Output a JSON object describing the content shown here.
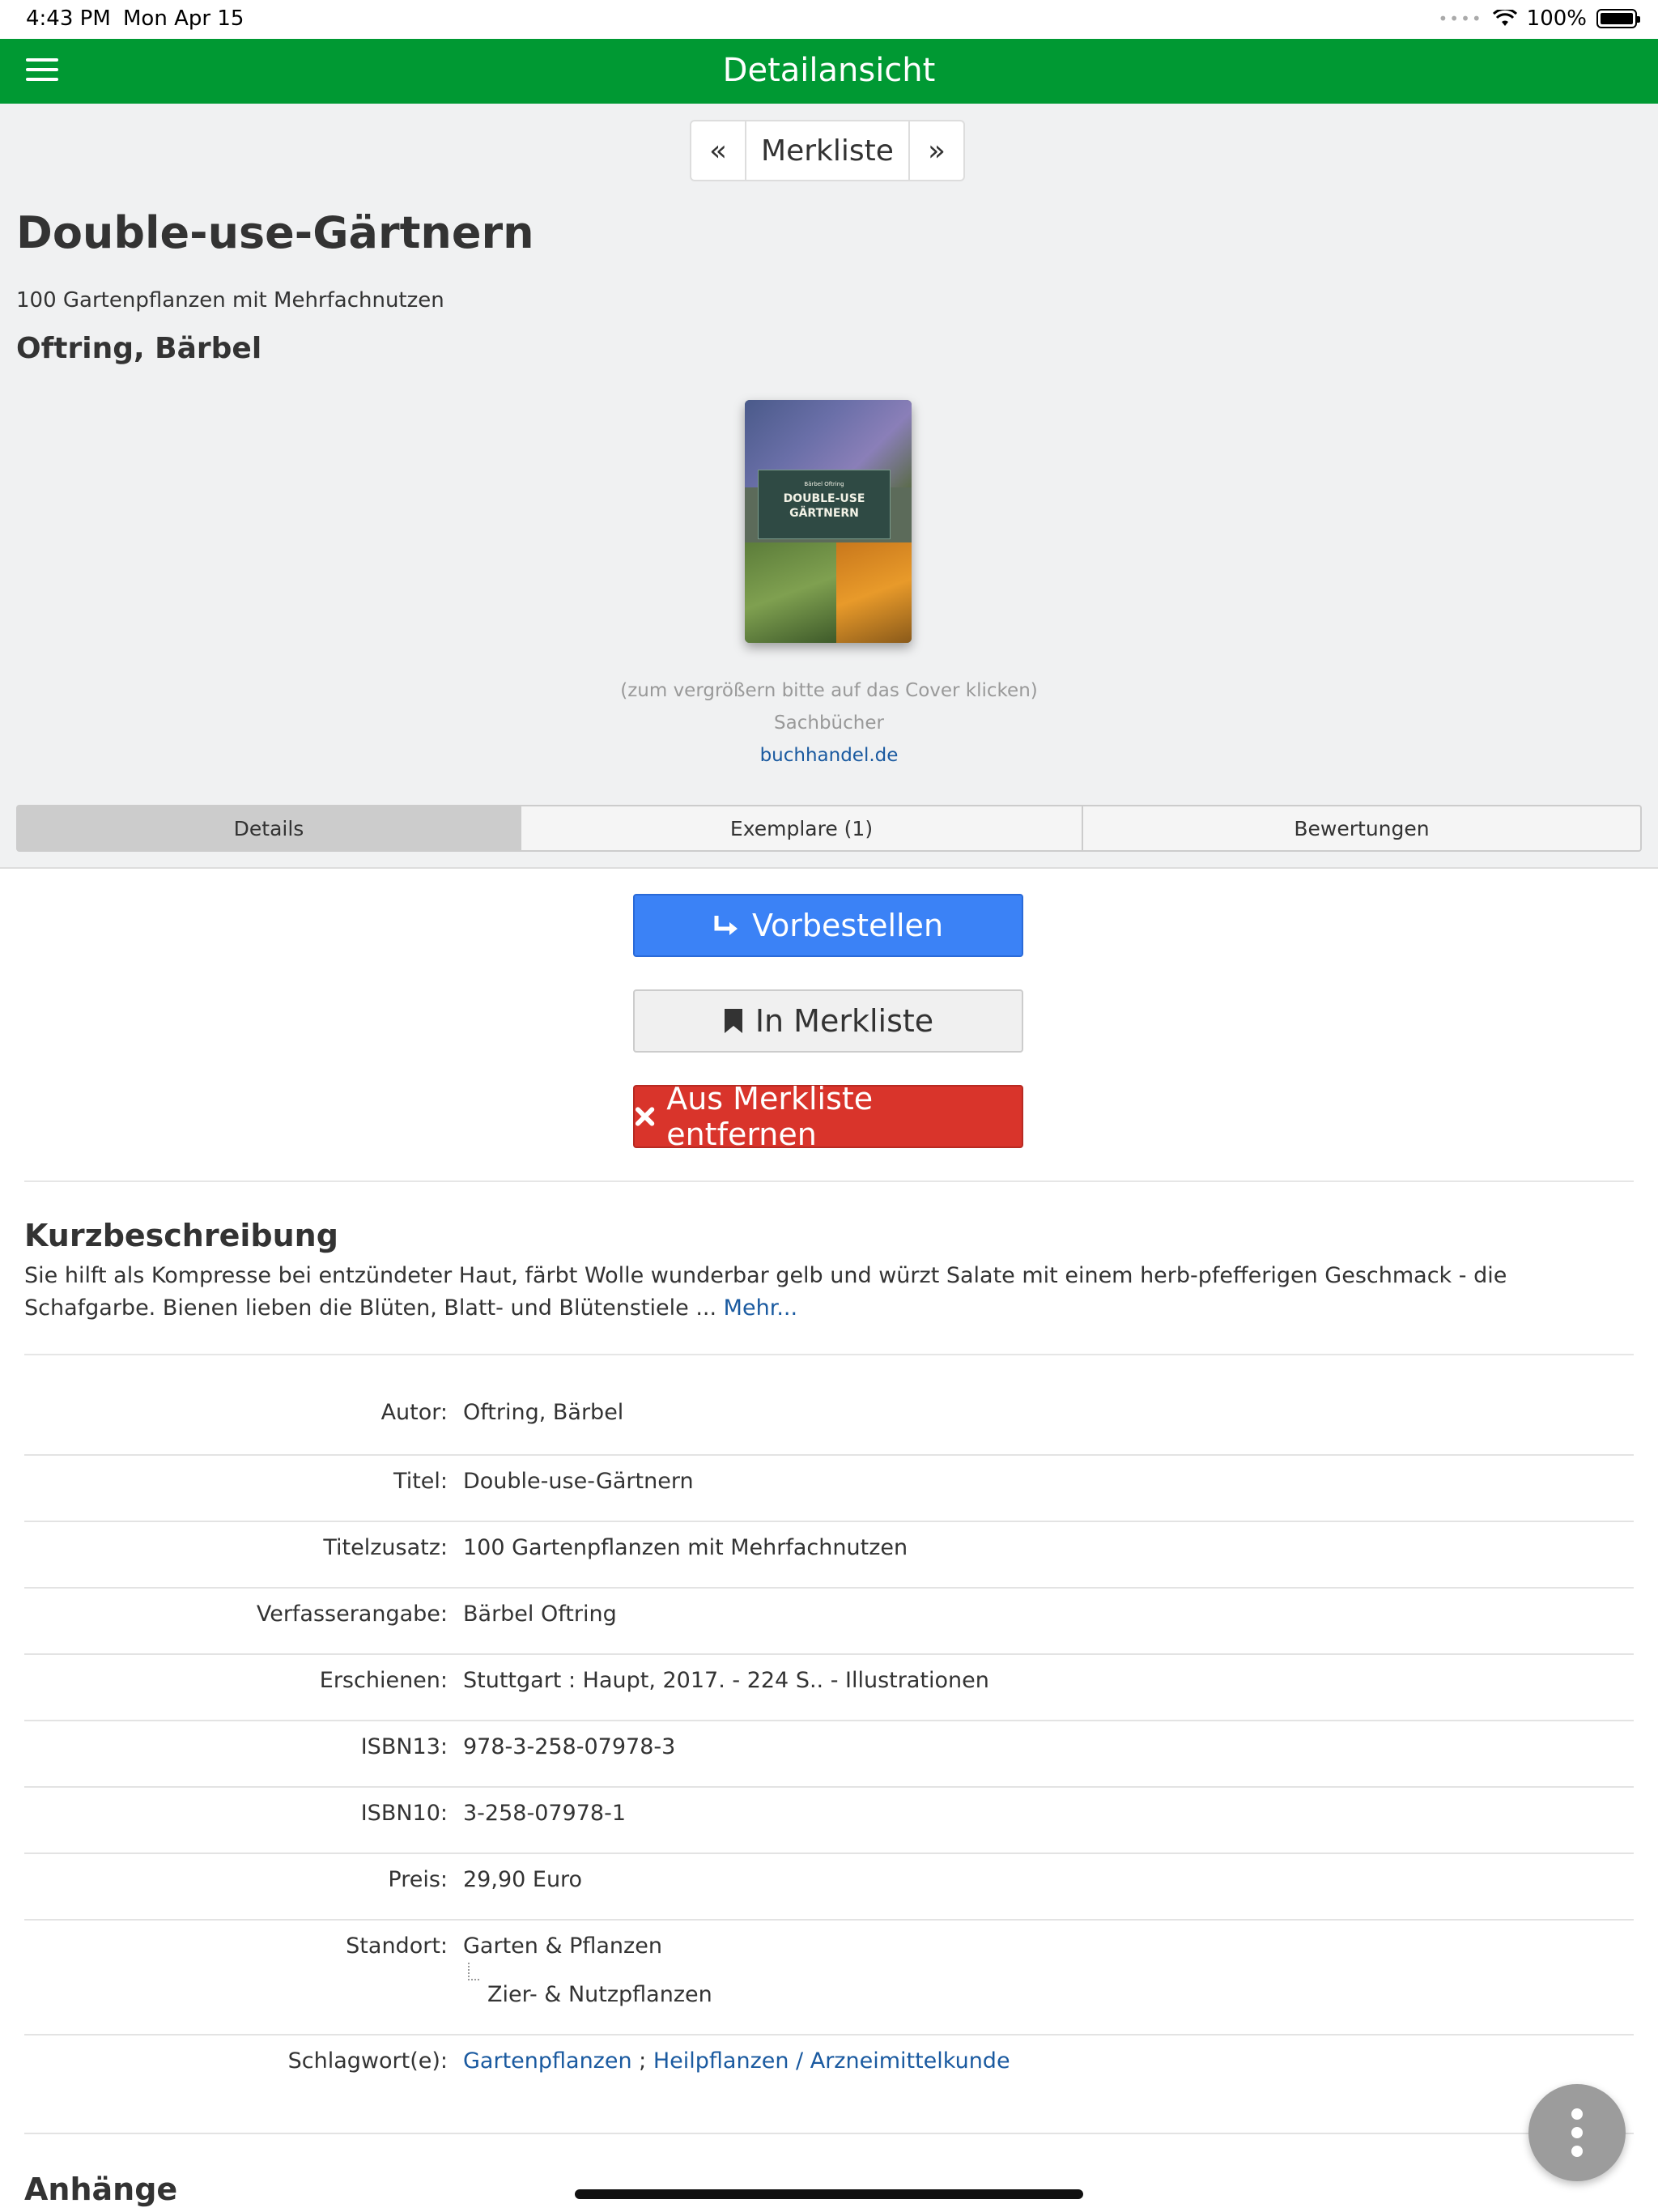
{
  "status_bar": {
    "time": "4:43 PM",
    "date": "Mon Apr 15",
    "battery": "100%"
  },
  "navbar": {
    "title": "Detailansicht"
  },
  "pager": {
    "prev": "«",
    "label": "Merkliste",
    "next": "»"
  },
  "book": {
    "title": "Double-use-Gärtnern",
    "subtitle": "100 Gartenpflanzen mit Mehrfachnutzen",
    "author": "Oftring, Bärbel"
  },
  "cover": {
    "author_line": "Bärbel Oftring",
    "title_line1": "DOUBLE-USE",
    "title_line2": "GÄRTNERN",
    "hint": "(zum vergrößern bitte auf das Cover klicken)",
    "category": "Sachbücher",
    "link": "buchhandel.de"
  },
  "tabs": [
    "Details",
    "Exemplare (1)",
    "Bewertungen"
  ],
  "buttons": {
    "reserve": "Vorbestellen",
    "add_list": "In Merkliste",
    "remove_list": "Aus Merkliste entfernen"
  },
  "description": {
    "heading": "Kurzbeschreibung",
    "text": "Sie hilft als Kompresse bei entzündeter Haut, färbt Wolle wunderbar gelb und würzt Salate mit einem herb-pfefferigen Geschmack - die Schafgarbe. Bienen lieben die Blüten, Blatt- und Blütenstiele ... ",
    "more": "Mehr..."
  },
  "details": {
    "author": {
      "label": "Autor:",
      "value": "Oftring, Bärbel"
    },
    "title": {
      "label": "Titel:",
      "value": "Double-use-Gärtnern"
    },
    "subtitle": {
      "label": "Titelzusatz:",
      "value": "100 Gartenpflanzen mit Mehrfachnutzen"
    },
    "statement": {
      "label": "Verfasserangabe:",
      "value": "Bärbel Oftring"
    },
    "published": {
      "label": "Erschienen:",
      "value": "Stuttgart : Haupt, 2017. - 224 S.. - Illustrationen"
    },
    "isbn13": {
      "label": "ISBN13:",
      "value": "978-3-258-07978-3"
    },
    "isbn10": {
      "label": "ISBN10:",
      "value": "3-258-07978-1"
    },
    "price": {
      "label": "Preis:",
      "value": "29,90 Euro"
    },
    "location": {
      "label": "Standort:",
      "value": "Garten & Pflanzen",
      "sub": "Zier- & Nutzpflanzen"
    },
    "keywords": {
      "label": "Schlagwort(e):",
      "k1": "Gartenpflanzen",
      "sep": " ; ",
      "k2": "Heilpflanzen / Arzneimittelkunde"
    }
  },
  "attachments": {
    "heading": "Anhänge"
  }
}
